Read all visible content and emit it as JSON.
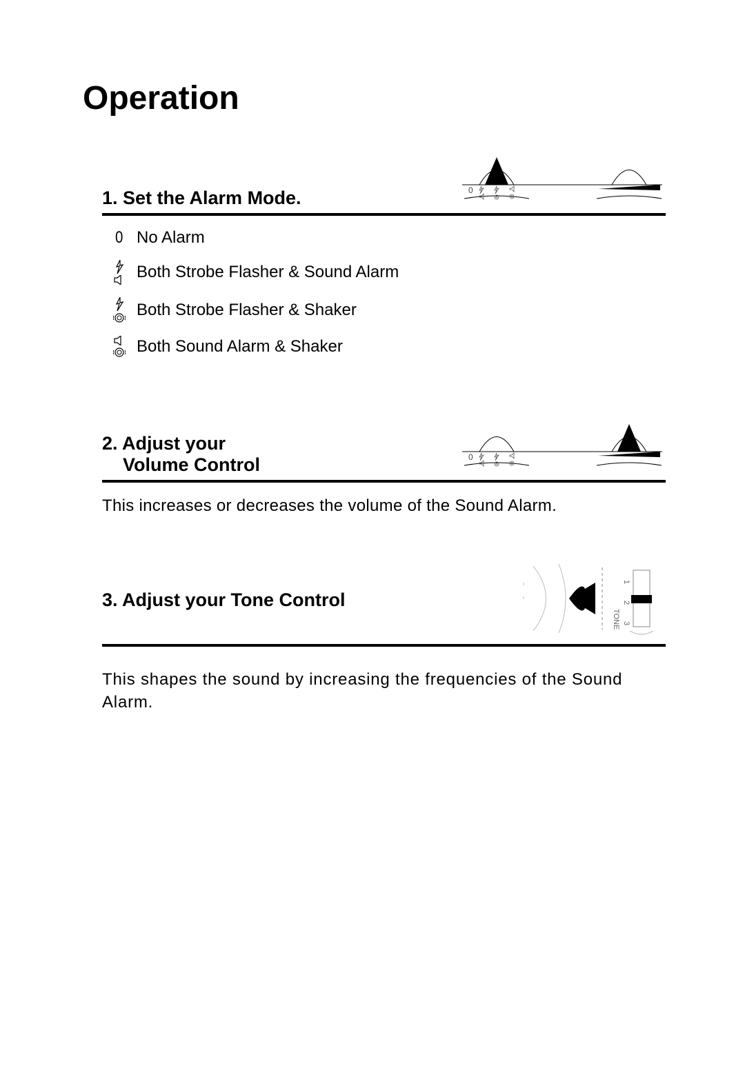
{
  "title": "Operation",
  "step1": {
    "heading": "1. Set the Alarm Mode.",
    "modes": [
      {
        "symbol": "0",
        "label": "No Alarm"
      },
      {
        "symbol": "bolt_speaker",
        "label": "Both Strobe Flasher & Sound Alarm"
      },
      {
        "symbol": "bolt_shaker",
        "label": "Both Strobe Flasher & Shaker"
      },
      {
        "symbol": "speaker_shaker",
        "label": "Both Sound Alarm & Shaker"
      }
    ],
    "dial_label": "0",
    "dial_positions": [
      "0",
      "bolt_speaker",
      "bolt_shaker",
      "speaker_shaker"
    ],
    "dial_selected_index": 1
  },
  "step2": {
    "heading": "2. Adjust your\n    Volume Control",
    "body": "This increases or decreases the volume of the Sound Alarm.",
    "dial_label": "0",
    "dial_positions": [
      "0",
      "bolt_speaker",
      "bolt_shaker",
      "speaker_shaker"
    ],
    "dial_selected_index": 3
  },
  "step3": {
    "heading": "3. Adjust your Tone Control",
    "body": "This shapes the sound by increasing the frequencies of the Sound Alarm.",
    "slider": {
      "label": "TONE",
      "ticks": [
        "1",
        "2",
        "3"
      ],
      "position": 2
    }
  }
}
